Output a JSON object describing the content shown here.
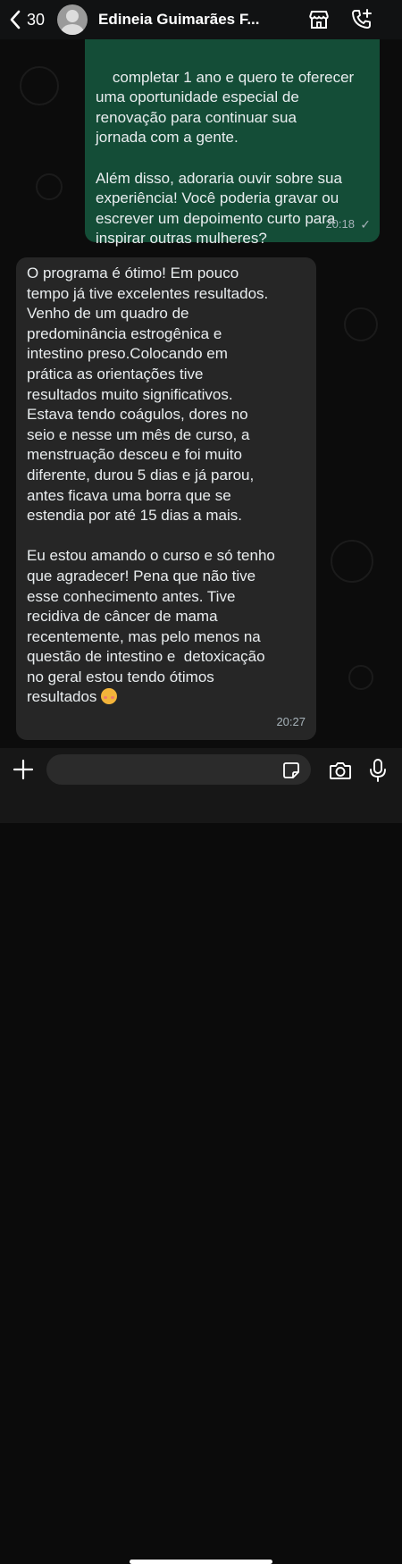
{
  "header": {
    "back_count": "30",
    "contact_name": "Edineia Guimarães  F..."
  },
  "messages": [
    {
      "direction": "outgoing",
      "text": "completar 1 ano e quero te oferecer\numa oportunidade especial de\nrenovação para continuar sua\njornada com a gente.\n\nAlém disso, adoraria ouvir sobre sua\nexperiência! Você poderia gravar ou\nescrever um depoimento curto para\ninspirar outras mulheres?",
      "time": "20:18",
      "status": "✓"
    },
    {
      "direction": "incoming",
      "text": "O programa é ótimo! Em pouco\ntempo já tive excelentes resultados.\nVenho de um quadro de\npredominância estrogênica e\nintestino preso.Colocando em\nprática as orientações tive\nresultados muito significativos.\nEstava tendo coágulos, dores no\nseio e nesse um mês de curso, a\nmenstruação desceu e foi muito\ndiferente, durou 5 dias e já parou,\nantes ficava uma borra que se\nestendia por até 15 dias a mais.\n\nEu estou amando o curso e só tenho\nque agradecer! Pena que não tive\nesse conhecimento antes. Tive\nrecidiva de câncer de mama\nrecentemente, mas pelo menos na\nquestão de intestino e  detoxicação\nno geral estou tendo ótimos\nresultados ",
      "emoji": "smiling-face-with-hearts",
      "time": "20:27"
    }
  ],
  "composer": {
    "value": ""
  },
  "colors": {
    "header_bg": "#111213",
    "outgoing_bubble": "#144d37",
    "incoming_bubble": "#262626",
    "timestamp": "#a7b3ba"
  }
}
